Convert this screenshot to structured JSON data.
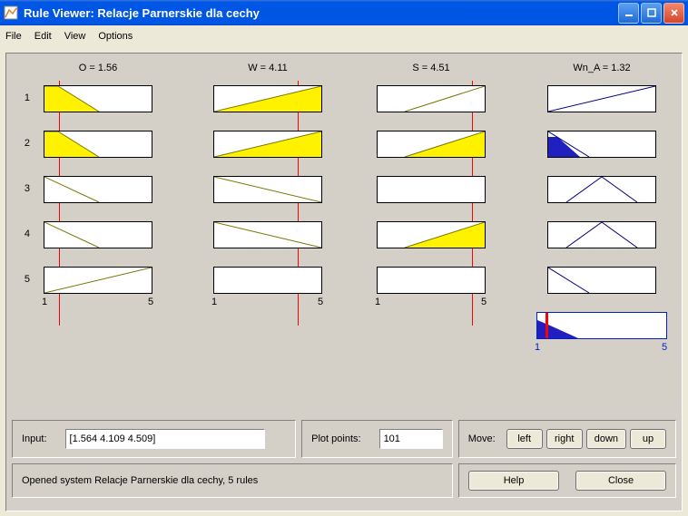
{
  "window": {
    "title": "Rule Viewer: Relacje Parnerskie dla cechy"
  },
  "menu": {
    "file": "File",
    "edit": "Edit",
    "view": "View",
    "options": "Options"
  },
  "columns": {
    "O": {
      "label": "O = 1.56",
      "min": "1",
      "max": "5",
      "value": 1.56
    },
    "W": {
      "label": "W = 4.11",
      "min": "1",
      "max": "5",
      "value": 4.11
    },
    "S": {
      "label": "S = 4.51",
      "min": "1",
      "max": "5",
      "value": 4.51
    },
    "Wn_A": {
      "label": "Wn_A = 1.32",
      "min": "1",
      "max": "5",
      "value": 1.32
    }
  },
  "rows": {
    "r1": "1",
    "r2": "2",
    "r3": "3",
    "r4": "4",
    "r5": "5"
  },
  "input_panel": {
    "label": "Input:",
    "value": "[1.564 4.109 4.509]"
  },
  "plot_panel": {
    "label": "Plot points:",
    "value": "101"
  },
  "move_panel": {
    "label": "Move:",
    "left": "left",
    "right": "right",
    "down": "down",
    "up": "up"
  },
  "status": {
    "text": "Opened system Relacje Parnerskie dla cechy, 5 rules"
  },
  "buttons": {
    "help": "Help",
    "close": "Close"
  },
  "chart_data": {
    "inputs": [
      {
        "name": "O",
        "value": 1.56,
        "range": [
          1,
          5
        ]
      },
      {
        "name": "W",
        "value": 4.11,
        "range": [
          1,
          5
        ]
      },
      {
        "name": "S",
        "value": 4.51,
        "range": [
          1,
          5
        ]
      }
    ],
    "output": {
      "name": "Wn_A",
      "value": 1.32,
      "range": [
        1,
        5
      ]
    },
    "rules": [
      {
        "O": {
          "shape": "trapL",
          "points": [
            [
              1,
              1
            ],
            [
              1.5,
              1
            ],
            [
              3,
              0
            ]
          ],
          "firing": 0.86
        },
        "W": {
          "shape": "triR",
          "points": [
            [
              1,
              0
            ],
            [
              5,
              1
            ]
          ],
          "firing": 0.78
        },
        "S": {
          "shape": "triR",
          "points": [
            [
              2,
              0
            ],
            [
              5,
              1
            ]
          ],
          "firing": 0.0
        },
        "out": {
          "shape": "triR",
          "points": [
            [
              1,
              0
            ],
            [
              5,
              1
            ]
          ],
          "clip": 0.0
        }
      },
      {
        "O": {
          "shape": "trapL",
          "points": [
            [
              1,
              1
            ],
            [
              1.5,
              1
            ],
            [
              3,
              0
            ]
          ],
          "firing": 0.86
        },
        "W": {
          "shape": "triR",
          "points": [
            [
              1,
              0
            ],
            [
              5,
              1
            ]
          ],
          "firing": 0.78
        },
        "S": {
          "shape": "triR",
          "points": [
            [
              2,
              0
            ],
            [
              5,
              1
            ]
          ],
          "firing": 0.84
        },
        "out": {
          "shape": "triL",
          "points": [
            [
              1,
              1
            ],
            [
              3,
              0
            ]
          ],
          "clip": 0.78
        }
      },
      {
        "O": {
          "shape": "triL",
          "points": [
            [
              1,
              1
            ],
            [
              3,
              0
            ]
          ],
          "firing": 0.0
        },
        "W": {
          "shape": "triL",
          "points": [
            [
              1,
              1
            ],
            [
              5,
              0
            ]
          ],
          "firing": 0.0
        },
        "S": {
          "shape": "none"
        },
        "out": {
          "shape": "tri",
          "points": [
            [
              1.5,
              0
            ],
            [
              3,
              1
            ],
            [
              4.5,
              0
            ]
          ],
          "clip": 0.0
        }
      },
      {
        "O": {
          "shape": "triL",
          "points": [
            [
              1,
              1
            ],
            [
              3,
              0
            ]
          ],
          "firing": 0.0
        },
        "W": {
          "shape": "triL",
          "points": [
            [
              1,
              1
            ],
            [
              5,
              0
            ]
          ],
          "firing": 0.0
        },
        "S": {
          "shape": "triR",
          "points": [
            [
              2,
              0
            ],
            [
              5,
              1
            ]
          ],
          "firing": 0.84
        },
        "out": {
          "shape": "tri",
          "points": [
            [
              1.5,
              0
            ],
            [
              3,
              1
            ],
            [
              4.5,
              0
            ]
          ],
          "clip": 0.0
        }
      },
      {
        "O": {
          "shape": "triR",
          "points": [
            [
              1,
              0
            ],
            [
              5,
              1
            ]
          ],
          "firing": 0.0
        },
        "W": {
          "shape": "none"
        },
        "S": {
          "shape": "none"
        },
        "out": {
          "shape": "triL",
          "points": [
            [
              1,
              1
            ],
            [
              3,
              0
            ]
          ],
          "clip": 0.0
        }
      }
    ],
    "aggregate_output": {
      "shape": "triL",
      "points": [
        [
          1,
          0.78
        ],
        [
          1.4,
          0.5
        ],
        [
          3,
          0
        ]
      ],
      "centroid": 1.32
    }
  }
}
